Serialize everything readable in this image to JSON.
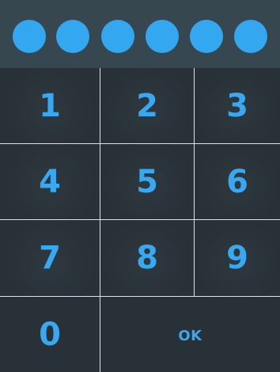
{
  "pin": {
    "dots": [
      {
        "filled": true,
        "color": "#33a7f0"
      },
      {
        "filled": true,
        "color": "#33a7f0"
      },
      {
        "filled": true,
        "color": "#33a7f0"
      },
      {
        "filled": true,
        "color": "#33a7f0"
      },
      {
        "filled": true,
        "color": "#33a7f0"
      },
      {
        "filled": true,
        "color": "#33a7f0"
      }
    ]
  },
  "keypad": {
    "key_1": "1",
    "key_2": "2",
    "key_3": "3",
    "key_4": "4",
    "key_5": "5",
    "key_6": "6",
    "key_7": "7",
    "key_8": "8",
    "key_9": "9",
    "key_0": "0",
    "ok": "OK"
  },
  "colors": {
    "accent": "#33a7f0",
    "background": "#283238",
    "pin_bar": "#37474f",
    "divider": "#dfe3e5"
  }
}
